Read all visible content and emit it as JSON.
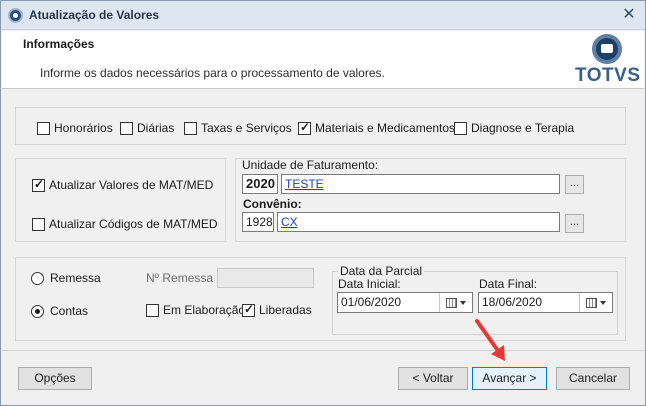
{
  "window": {
    "title": "Atualização de Valores",
    "close_glyph": "✕"
  },
  "header": {
    "title": "Informações",
    "description": "Informe os dados necessários para o processamento de valores.",
    "logo_text": "TOTVS"
  },
  "categories": [
    {
      "label": "Honorários",
      "checked": false
    },
    {
      "label": "Diárias",
      "checked": false
    },
    {
      "label": "Taxas e Serviços",
      "checked": false
    },
    {
      "label": "Materiais e Medicamentos",
      "checked": true
    },
    {
      "label": "Diagnose e Terapia",
      "checked": false
    }
  ],
  "update_options": {
    "update_values": {
      "label": "Atualizar Valores de MAT/MED",
      "checked": true
    },
    "update_codes": {
      "label": "Atualizar Códigos de MAT/MED",
      "checked": false
    }
  },
  "billing": {
    "unit_label": "Unidade de Faturamento:",
    "unit_code": "2020",
    "unit_name": "TESTE",
    "agreement_label": "Convênio:",
    "agreement_code": "1928",
    "agreement_name": "CX",
    "lookup_glyph": "..."
  },
  "processing": {
    "remessa_label": "Remessa",
    "contas_label": "Contas",
    "selected": "Contas",
    "remessa_number_label": "Nº Remessa",
    "remessa_number_value": "",
    "in_progress": {
      "label": "Em Elaboração",
      "checked": false
    },
    "released": {
      "label": "Liberadas",
      "checked": true
    }
  },
  "partial_date": {
    "legend": "Data da Parcial",
    "start_label": "Data Inicial:",
    "start_value": "01/06/2020",
    "end_label": "Data Final:",
    "end_value": "18/06/2020"
  },
  "footer": {
    "options_label": "Opções",
    "back_label": "< Voltar",
    "next_label": "Avançar >",
    "cancel_label": "Cancelar"
  },
  "colors": {
    "link": "#1f3ec8",
    "accent_border": "#0078d7",
    "annotation_arrow": "#e53935",
    "brand": "#3a5f88"
  }
}
